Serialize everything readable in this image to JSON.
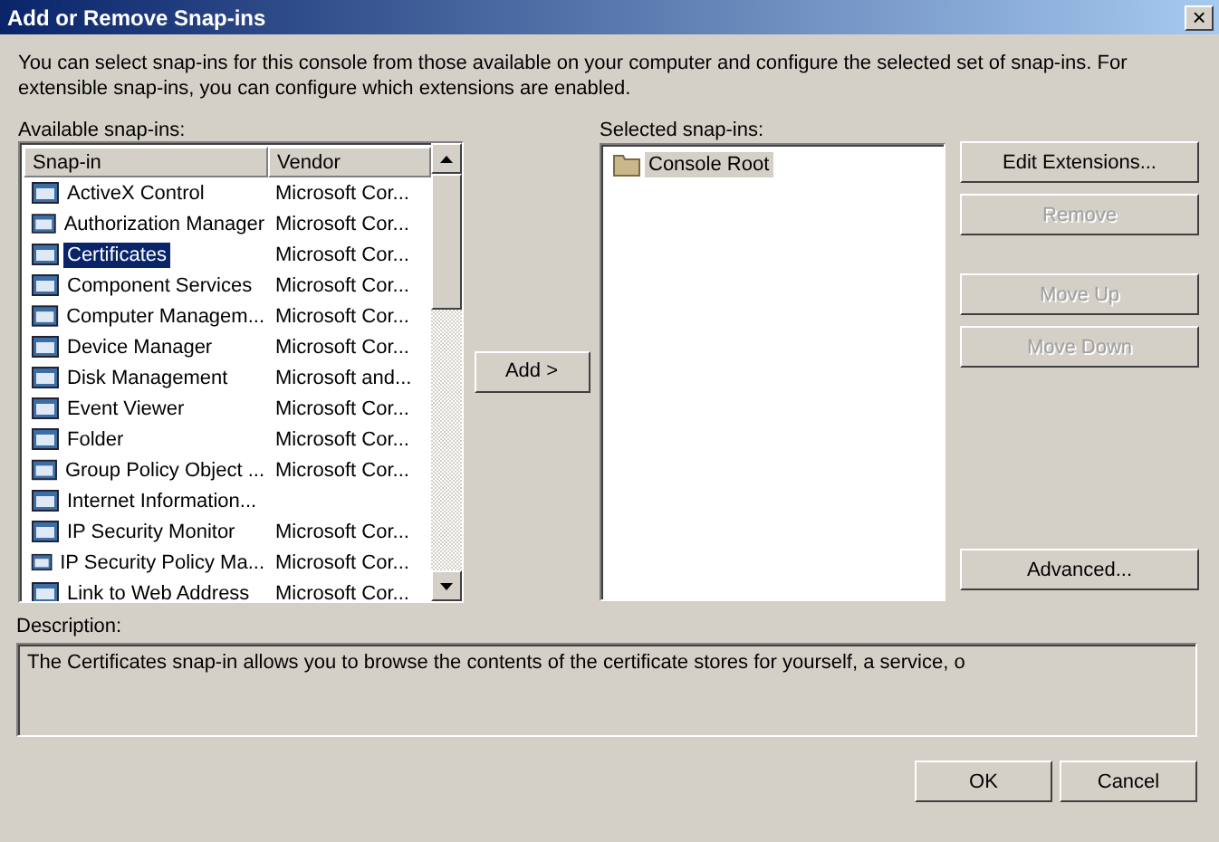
{
  "window": {
    "title": "Add or Remove Snap-ins",
    "close": "×"
  },
  "intro": "You can select snap-ins for this console from those available on your computer and configure the selected set of snap-ins. For extensible snap-ins, you can configure which extensions are enabled.",
  "available": {
    "label": "Available snap-ins:",
    "columns": [
      "Snap-in",
      "Vendor"
    ],
    "rows": [
      {
        "name": "ActiveX Control",
        "vendor": "Microsoft Cor...",
        "selected": false
      },
      {
        "name": "Authorization Manager",
        "vendor": "Microsoft Cor...",
        "selected": false
      },
      {
        "name": "Certificates",
        "vendor": "Microsoft Cor...",
        "selected": true
      },
      {
        "name": "Component Services",
        "vendor": "Microsoft Cor...",
        "selected": false
      },
      {
        "name": "Computer Managem...",
        "vendor": "Microsoft Cor...",
        "selected": false
      },
      {
        "name": "Device Manager",
        "vendor": "Microsoft Cor...",
        "selected": false
      },
      {
        "name": "Disk Management",
        "vendor": "Microsoft and...",
        "selected": false
      },
      {
        "name": "Event Viewer",
        "vendor": "Microsoft Cor...",
        "selected": false
      },
      {
        "name": "Folder",
        "vendor": "Microsoft Cor...",
        "selected": false
      },
      {
        "name": "Group Policy Object ...",
        "vendor": "Microsoft Cor...",
        "selected": false
      },
      {
        "name": "Internet Information...",
        "selected": false
      },
      {
        "name": "IP Security Monitor",
        "vendor": "Microsoft Cor...",
        "selected": false
      },
      {
        "name": "IP Security Policy Ma...",
        "vendor": "Microsoft Cor...",
        "selected": false
      },
      {
        "name": "Link to Web Address",
        "vendor": "Microsoft Cor...",
        "selected": false
      }
    ]
  },
  "add_button": {
    "label": "Add >",
    "disabled": false
  },
  "selected_list": {
    "label": "Selected snap-ins:",
    "items": [
      {
        "name": "Console Root",
        "selected": true
      }
    ]
  },
  "side_buttons": [
    {
      "label": "Edit Extensions...",
      "disabled": false
    },
    {
      "label": "Remove",
      "disabled": true
    },
    {
      "label": "Move Up",
      "disabled": true
    },
    {
      "label": "Move Down",
      "disabled": true
    },
    {
      "label": "Advanced...",
      "disabled": false
    }
  ],
  "description": {
    "label": "Description:",
    "text": "The Certificates snap-in allows you to browse the contents of the certificate stores for yourself, a service, o"
  },
  "buttons": [
    {
      "label": "OK",
      "disabled": false
    },
    {
      "label": "Cancel",
      "disabled": false
    }
  ]
}
